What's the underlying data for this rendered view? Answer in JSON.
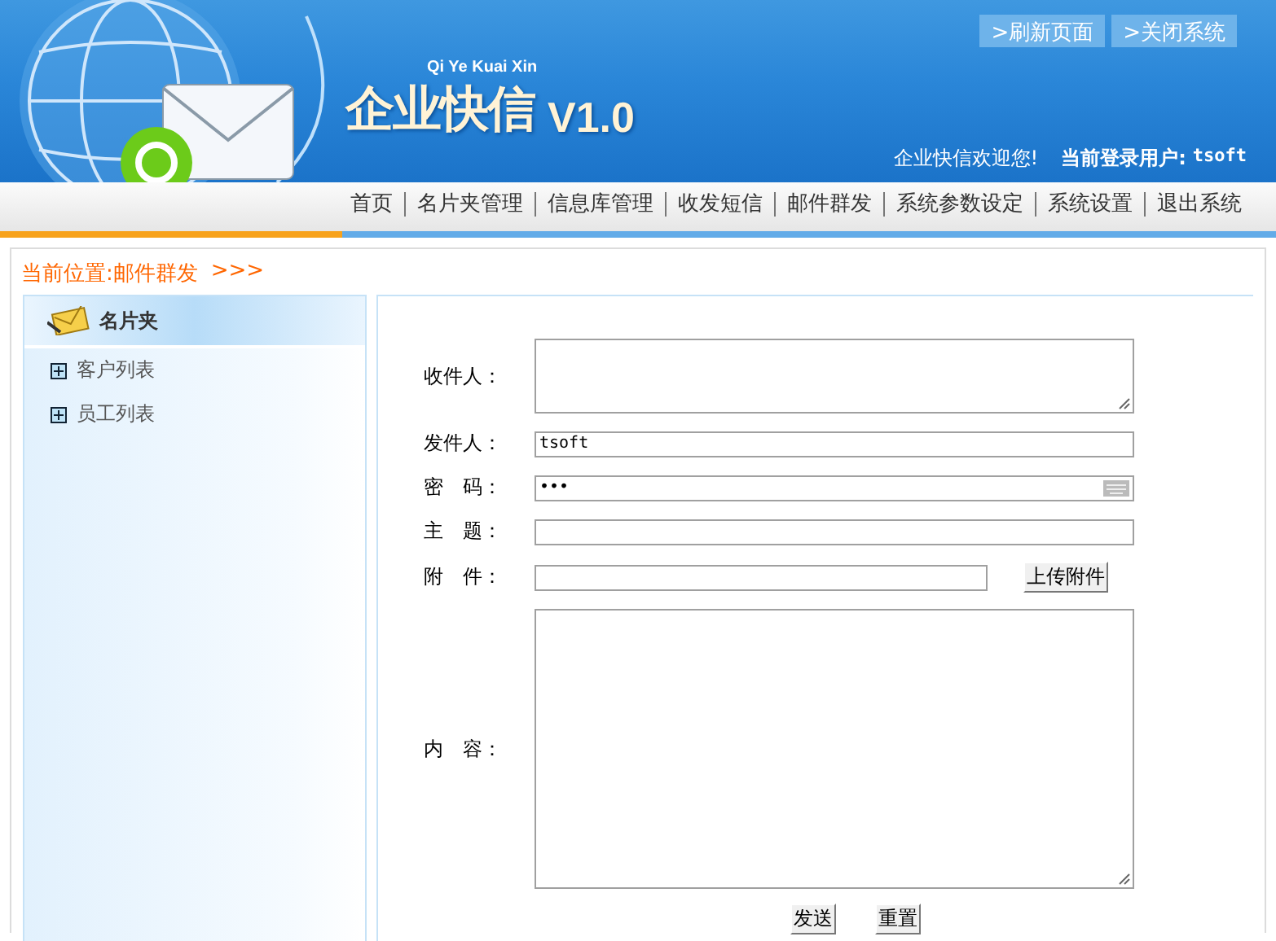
{
  "header": {
    "logo_pinyin": "Qi Ye Kuai Xin",
    "logo_title": "企业快信",
    "logo_version": "V1.0",
    "top_buttons": [
      ">刷新页面",
      ">关闭系统"
    ],
    "welcome": "企业快信欢迎您!",
    "user_label": "当前登录用户:",
    "user": "tsoft"
  },
  "nav": [
    "首页",
    "名片夹管理",
    "信息库管理",
    "收发短信",
    "邮件群发",
    "系统参数设定",
    "系统设置",
    "退出系统"
  ],
  "breadcrumb": {
    "label": "当前位置:",
    "page": "邮件群发",
    "arrows": ">>>"
  },
  "sidebar": {
    "title": "名片夹",
    "items": [
      {
        "label": "客户列表",
        "expanded": false
      },
      {
        "label": "员工列表",
        "expanded": false
      }
    ]
  },
  "form": {
    "fields": [
      {
        "label": "收件人：",
        "kind": "textarea"
      },
      {
        "label": "发件人：",
        "kind": "text",
        "value": "tsoft"
      },
      {
        "label": "密　码：",
        "kind": "password",
        "value": "•••"
      },
      {
        "label": "主　题：",
        "kind": "text"
      },
      {
        "label": "附　件：",
        "kind": "file",
        "button": "上传附件"
      },
      {
        "label": "内　容：",
        "kind": "bigtextarea"
      }
    ],
    "buttons": [
      "发送",
      "重置"
    ]
  }
}
